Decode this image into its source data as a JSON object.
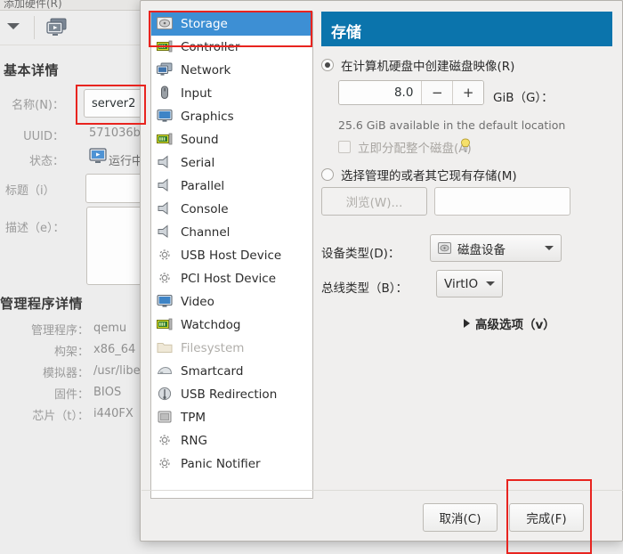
{
  "background": {
    "menu_text": "添加硬件(R)",
    "toolbar": {
      "dropdown_icon": "caret-down-icon",
      "console_icon": "vm-console-icon"
    },
    "basic_section_title": "基本详情",
    "fields": [
      {
        "label": "名称(N)：",
        "value": "server2",
        "type": "entry"
      },
      {
        "label": "UUID：",
        "value": "571036b",
        "type": "text"
      },
      {
        "label": "状态：",
        "value": "运行中",
        "type": "status",
        "icon": "running-icon"
      },
      {
        "label": "标题（i）",
        "value": "",
        "type": "entry"
      },
      {
        "label": "描述（e）：",
        "value": "",
        "type": "textarea"
      }
    ],
    "hypervisor_section_title": "管理程序详情",
    "hypervisor_fields": [
      {
        "label": "管理程序：",
        "value": "qemu"
      },
      {
        "label": "构架：",
        "value": "x86_64"
      },
      {
        "label": "模拟器：",
        "value": "/usr/libex"
      },
      {
        "label": "固件：",
        "value": "BIOS"
      },
      {
        "label": "芯片（t）：",
        "value": "i440FX"
      }
    ]
  },
  "dialog": {
    "device_list": [
      {
        "label": "Storage",
        "icon": "storage-icon",
        "selected": true,
        "disabled": false
      },
      {
        "label": "Controller",
        "icon": "controller-icon",
        "selected": false,
        "disabled": false
      },
      {
        "label": "Network",
        "icon": "network-icon",
        "selected": false,
        "disabled": false
      },
      {
        "label": "Input",
        "icon": "input-mouse-icon",
        "selected": false,
        "disabled": false
      },
      {
        "label": "Graphics",
        "icon": "graphics-icon",
        "selected": false,
        "disabled": false
      },
      {
        "label": "Sound",
        "icon": "sound-icon",
        "selected": false,
        "disabled": false
      },
      {
        "label": "Serial",
        "icon": "serial-port-icon",
        "selected": false,
        "disabled": false
      },
      {
        "label": "Parallel",
        "icon": "parallel-port-icon",
        "selected": false,
        "disabled": false
      },
      {
        "label": "Console",
        "icon": "console-port-icon",
        "selected": false,
        "disabled": false
      },
      {
        "label": "Channel",
        "icon": "channel-port-icon",
        "selected": false,
        "disabled": false
      },
      {
        "label": "USB Host Device",
        "icon": "usb-host-icon",
        "selected": false,
        "disabled": false
      },
      {
        "label": "PCI Host Device",
        "icon": "pci-host-icon",
        "selected": false,
        "disabled": false
      },
      {
        "label": "Video",
        "icon": "video-icon",
        "selected": false,
        "disabled": false
      },
      {
        "label": "Watchdog",
        "icon": "watchdog-icon",
        "selected": false,
        "disabled": false
      },
      {
        "label": "Filesystem",
        "icon": "filesystem-icon",
        "selected": false,
        "disabled": true
      },
      {
        "label": "Smartcard",
        "icon": "smartcard-icon",
        "selected": false,
        "disabled": false
      },
      {
        "label": "USB Redirection",
        "icon": "usb-redirection-icon",
        "selected": false,
        "disabled": false
      },
      {
        "label": "TPM",
        "icon": "tpm-icon",
        "selected": false,
        "disabled": false
      },
      {
        "label": "RNG",
        "icon": "rng-icon",
        "selected": false,
        "disabled": false
      },
      {
        "label": "Panic Notifier",
        "icon": "panic-notifier-icon",
        "selected": false,
        "disabled": false
      }
    ],
    "pane_title": "存储",
    "create_image_radio": {
      "label": "在计算机硬盘中创建磁盘映像(R)",
      "selected": true
    },
    "size_spinner": {
      "value": "8.0",
      "minus": "−",
      "plus": "+"
    },
    "size_unit_label": "GiB（G）：",
    "available_text": "25.6 GiB available in the default location",
    "allocate_checkbox": {
      "label": "立即分配整个磁盘(A)",
      "checked": false,
      "disabled": true,
      "icon": "lightbulb-icon"
    },
    "select_storage_radio": {
      "label": "选择管理的或者其它现有存储(M)",
      "selected": false
    },
    "browse_button": {
      "label": "浏览(W)...",
      "disabled": true
    },
    "storage_path_input": {
      "value": "",
      "placeholder": ""
    },
    "device_type_label": "设备类型(D)：",
    "device_type_value": "磁盘设备",
    "device_type_icon": "disk-device-icon",
    "bus_type_label": "总线类型（B）：",
    "bus_type_value": "VirtIO",
    "advanced_expander": "高级选项（v）",
    "cancel_button": "取消(C)",
    "finish_button": "完成(F)"
  },
  "annotations": {
    "accent_red": "#e8241f",
    "accent_blue": "#3d8fd4",
    "header_blue": "#0b74ac"
  }
}
